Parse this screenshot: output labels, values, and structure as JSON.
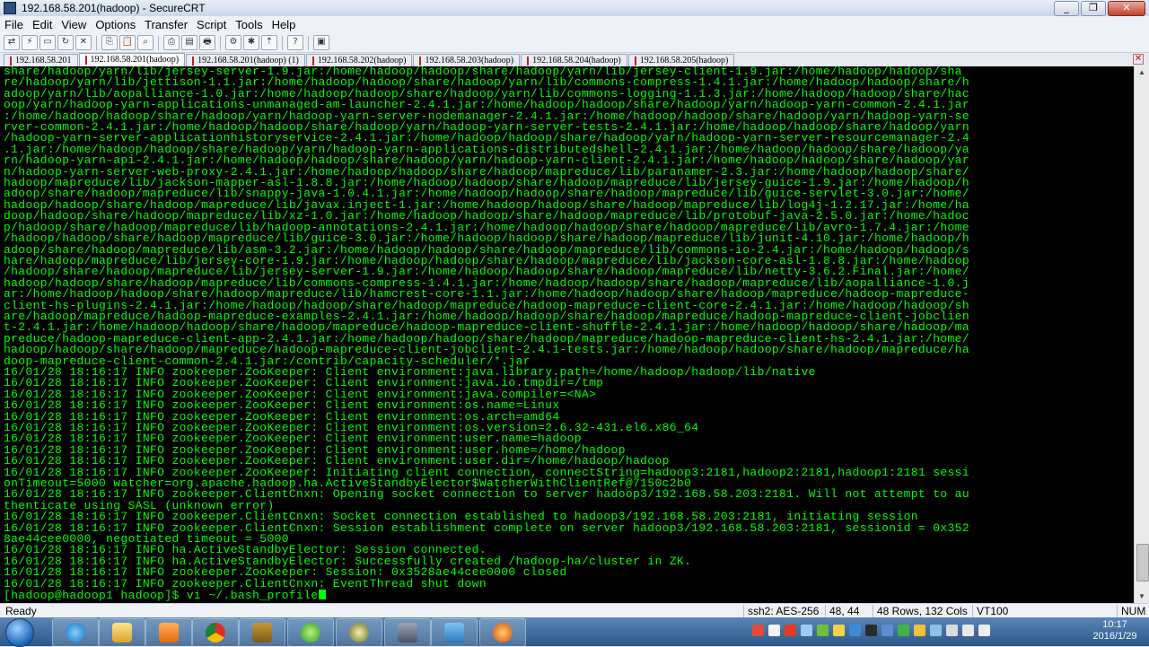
{
  "window": {
    "title": "192.168.58.201(hadoop) - SecureCRT"
  },
  "window_buttons": [
    "_",
    "❐",
    "✕"
  ],
  "menu": [
    "File",
    "Edit",
    "View",
    "Options",
    "Transfer",
    "Script",
    "Tools",
    "Help"
  ],
  "tabs": [
    {
      "label": "192.168.58.201"
    },
    {
      "label": "192.168.58.201(hadoop)",
      "active": true
    },
    {
      "label": "192.168.58.201(hadoop)  (1)"
    },
    {
      "label": "192.168.58.202(hadoop)"
    },
    {
      "label": "192.168.58.203(hadoop)"
    },
    {
      "label": "192.168.58.204(hadoop)"
    },
    {
      "label": "192.168.58.205(hadoop)"
    }
  ],
  "terminal": {
    "lines": [
      "share/hadoop/yarn/lib/jersey-server-1.9.jar:/home/hadoop/hadoop/share/hadoop/yarn/lib/jersey-client-1.9.jar:/home/hadoop/hadoop/sha",
      "re/hadoop/yarn/lib/jettison-1.1.jar:/home/hadoop/hadoop/share/hadoop/yarn/lib/commons-compress-1.4.1.jar:/home/hadoop/hadoop/share/h",
      "adoop/yarn/lib/aopalliance-1.0.jar:/home/hadoop/hadoop/share/hadoop/yarn/lib/commons-logging-1.1.3.jar:/home/hadoop/hadoop/share/hac",
      "oop/yarn/hadoop-yarn-applications-unmanaged-am-launcher-2.4.1.jar:/home/hadoop/hadoop/share/hadoop/yarn/hadoop-yarn-common-2.4.1.jar",
      ":/home/hadoop/hadoop/share/hadoop/yarn/hadoop-yarn-server-nodemanager-2.4.1.jar:/home/hadoop/hadoop/share/hadoop/yarn/hadoop-yarn-se",
      "rver-common-2.4.1.jar:/home/hadoop/hadoop/share/hadoop/yarn/hadoop-yarn-server-tests-2.4.1.jar:/home/hadoop/hadoop/share/hadoop/yarn",
      "/hadoop-yarn-server-applicationhistoryservice-2.4.1.jar:/home/hadoop/hadoop/share/hadoop/yarn/hadoop-yarn-server-resourcemanager-2.4",
      ".1.jar:/home/hadoop/hadoop/share/hadoop/yarn/hadoop-yarn-applications-distributedshell-2.4.1.jar:/home/hadoop/hadoop/share/hadoop/ya",
      "rn/hadoop-yarn-api-2.4.1.jar:/home/hadoop/hadoop/share/hadoop/yarn/hadoop-yarn-client-2.4.1.jar:/home/hadoop/hadoop/share/hadoop/yar",
      "n/hadoop-yarn-server-web-proxy-2.4.1.jar:/home/hadoop/hadoop/share/hadoop/mapreduce/lib/paranamer-2.3.jar:/home/hadoop/hadoop/share/",
      "hadoop/mapreduce/lib/jackson-mapper-asl-1.8.8.jar:/home/hadoop/hadoop/share/hadoop/mapreduce/lib/jersey-guice-1.9.jar:/home/hadoop/h",
      "adoop/share/hadoop/mapreduce/lib/snappy-java-1.0.4.1.jar:/home/hadoop/hadoop/share/hadoop/mapreduce/lib/guice-servlet-3.0.jar:/home/",
      "hadoop/hadoop/share/hadoop/mapreduce/lib/javax.inject-1.jar:/home/hadoop/hadoop/share/hadoop/mapreduce/lib/log4j-1.2.17.jar:/home/ha",
      "doop/hadoop/share/hadoop/mapreduce/lib/xz-1.0.jar:/home/hadoop/hadoop/share/hadoop/mapreduce/lib/protobuf-java-2.5.0.jar:/home/hadoc",
      "p/hadoop/share/hadoop/mapreduce/lib/hadoop-annotations-2.4.1.jar:/home/hadoop/hadoop/share/hadoop/mapreduce/lib/avro-1.7.4.jar:/home",
      "/hadoop/hadoop/share/hadoop/mapreduce/lib/guice-3.0.jar:/home/hadoop/hadoop/share/hadoop/mapreduce/lib/junit-4.10.jar:/home/hadoop/h",
      "adoop/share/hadoop/mapreduce/lib/asm-3.2.jar:/home/hadoop/hadoop/share/hadoop/mapreduce/lib/commons-io-2.4.jar:/home/hadoop/hadoop/s",
      "hare/hadoop/mapreduce/lib/jersey-core-1.9.jar:/home/hadoop/hadoop/share/hadoop/mapreduce/lib/jackson-core-asl-1.8.8.jar:/home/hadoop",
      "/hadoop/share/hadoop/mapreduce/lib/jersey-server-1.9.jar:/home/hadoop/hadoop/share/hadoop/mapreduce/lib/netty-3.6.2.Final.jar:/home/",
      "hadoop/hadoop/share/hadoop/mapreduce/lib/commons-compress-1.4.1.jar:/home/hadoop/hadoop/share/hadoop/mapreduce/lib/aopalliance-1.0.j",
      "ar:/home/hadoop/hadoop/share/hadoop/mapreduce/lib/hamcrest-core-1.1.jar:/home/hadoop/hadoop/share/hadoop/mapreduce/hadoop-mapreduce-",
      "client-hs-plugins-2.4.1.jar:/home/hadoop/hadoop/share/hadoop/mapreduce/hadoop-mapreduce-client-core-2.4.1.jar:/home/hadoop/hadoop/sh",
      "are/hadoop/mapreduce/hadoop-mapreduce-examples-2.4.1.jar:/home/hadoop/hadoop/share/hadoop/mapreduce/hadoop-mapreduce-client-jobclien",
      "t-2.4.1.jar:/home/hadoop/hadoop/share/hadoop/mapreduce/hadoop-mapreduce-client-shuffle-2.4.1.jar:/home/hadoop/hadoop/share/hadoop/ma",
      "preduce/hadoop-mapreduce-client-app-2.4.1.jar:/home/hadoop/hadoop/share/hadoop/mapreduce/hadoop-mapreduce-client-hs-2.4.1.jar:/home/",
      "hadoop/hadoop/share/hadoop/mapreduce/hadoop-mapreduce-client-jobclient-2.4.1-tests.jar:/home/hadoop/hadoop/share/hadoop/mapreduce/ha",
      "doop-mapreduce-client-common-2.4.1.jar:/contrib/capacity-scheduler/*.jar",
      "16/01/28 18:16:17 INFO zookeeper.ZooKeeper: Client environment:java.library.path=/home/hadoop/hadoop/lib/native",
      "16/01/28 18:16:17 INFO zookeeper.ZooKeeper: Client environment:java.io.tmpdir=/tmp",
      "16/01/28 18:16:17 INFO zookeeper.ZooKeeper: Client environment:java.compiler=<NA>",
      "16/01/28 18:16:17 INFO zookeeper.ZooKeeper: Client environment:os.name=Linux",
      "16/01/28 18:16:17 INFO zookeeper.ZooKeeper: Client environment:os.arch=amd64",
      "16/01/28 18:16:17 INFO zookeeper.ZooKeeper: Client environment:os.version=2.6.32-431.el6.x86_64",
      "16/01/28 18:16:17 INFO zookeeper.ZooKeeper: Client environment:user.name=hadoop",
      "16/01/28 18:16:17 INFO zookeeper.ZooKeeper: Client environment:user.home=/home/hadoop",
      "16/01/28 18:16:17 INFO zookeeper.ZooKeeper: Client environment:user.dir=/home/hadoop/hadoop",
      "16/01/28 18:16:17 INFO zookeeper.ZooKeeper: Initiating client connection, connectString=hadoop3:2181,hadoop2:2181,hadoop1:2181 sessi",
      "onTimeout=5000 watcher=org.apache.hadoop.ha.ActiveStandbyElector$WatcherWithClientRef@7150c2b0",
      "16/01/28 18:16:17 INFO zookeeper.ClientCnxn: Opening socket connection to server hadoop3/192.168.58.203:2181. Will not attempt to au",
      "thenticate using SASL (unknown error)",
      "16/01/28 18:16:17 INFO zookeeper.ClientCnxn: Socket connection established to hadoop3/192.168.58.203:2181, initiating session",
      "16/01/28 18:16:17 INFO zookeeper.ClientCnxn: Session establishment complete on server hadoop3/192.168.58.203:2181, sessionid = 0x352",
      "8ae44cee0000, negotiated timeout = 5000",
      "16/01/28 18:16:17 INFO ha.ActiveStandbyElector: Session connected.",
      "16/01/28 18:16:17 INFO ha.ActiveStandbyElector: Successfully created /hadoop-ha/cluster in ZK.",
      "16/01/28 18:16:17 INFO zookeeper.ZooKeeper: Session: 0x3528ae44cee0000 closed",
      "16/01/28 18:16:17 INFO zookeeper.ClientCnxn: EventThread shut down"
    ],
    "prompt": "[hadoop@hadoop1 hadoop]$ vi ~/.bash_profile",
    "text_color": "#00ff00",
    "background": "#000000"
  },
  "status": {
    "ready": "Ready",
    "cipher": "ssh2: AES-256",
    "position": "48, 44",
    "size": "48 Rows, 132 Cols",
    "emulation": "VT100",
    "num": "NUM"
  },
  "clock": {
    "time": "10:17",
    "date": "2016/1/29"
  }
}
